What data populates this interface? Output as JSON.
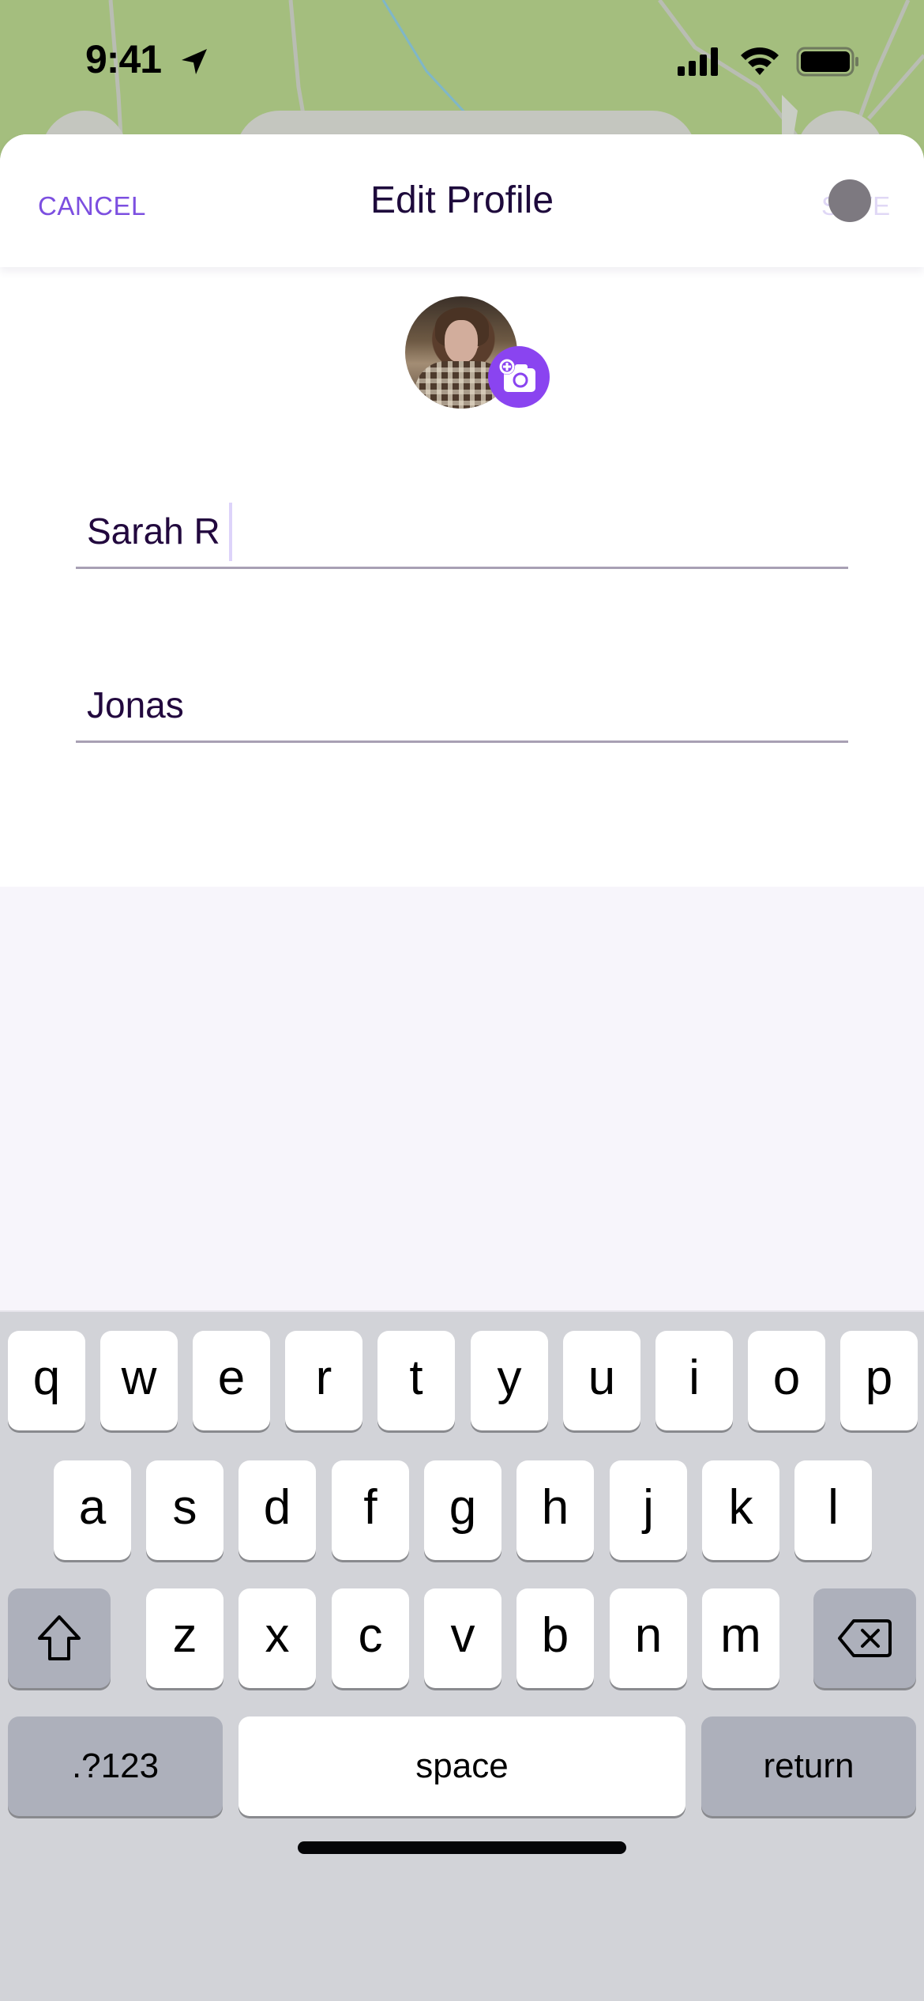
{
  "status_bar": {
    "time": "9:41",
    "icons": [
      "location-arrow-icon",
      "cellular-signal-icon",
      "wifi-icon",
      "battery-icon"
    ]
  },
  "nav": {
    "cancel_label": "CANCEL",
    "title": "Edit Profile",
    "save_label": "SAVE"
  },
  "profile": {
    "avatar_icon": "profile-photo",
    "camera_icon": "add-photo-camera-icon"
  },
  "fields": {
    "first_name": {
      "value": "Sarah R"
    },
    "last_name": {
      "value": "Jonas"
    }
  },
  "keyboard": {
    "row1": [
      "q",
      "w",
      "e",
      "r",
      "t",
      "y",
      "u",
      "i",
      "o",
      "p"
    ],
    "row2": [
      "a",
      "s",
      "d",
      "f",
      "g",
      "h",
      "j",
      "k",
      "l"
    ],
    "row3": [
      "z",
      "x",
      "c",
      "v",
      "b",
      "n",
      "m"
    ],
    "shift_icon": "shift-arrow-icon",
    "delete_icon": "backspace-icon",
    "numbers_label": ".?123",
    "space_label": "space",
    "return_label": "return"
  },
  "colors": {
    "accent": "#8a44f0",
    "cancel_text": "#7c4fe0",
    "title_text": "#1e0a3c",
    "save_disabled": "#e0d8f6",
    "map_green": "#a4be7e",
    "keyboard_bg": "#d2d3d8"
  }
}
